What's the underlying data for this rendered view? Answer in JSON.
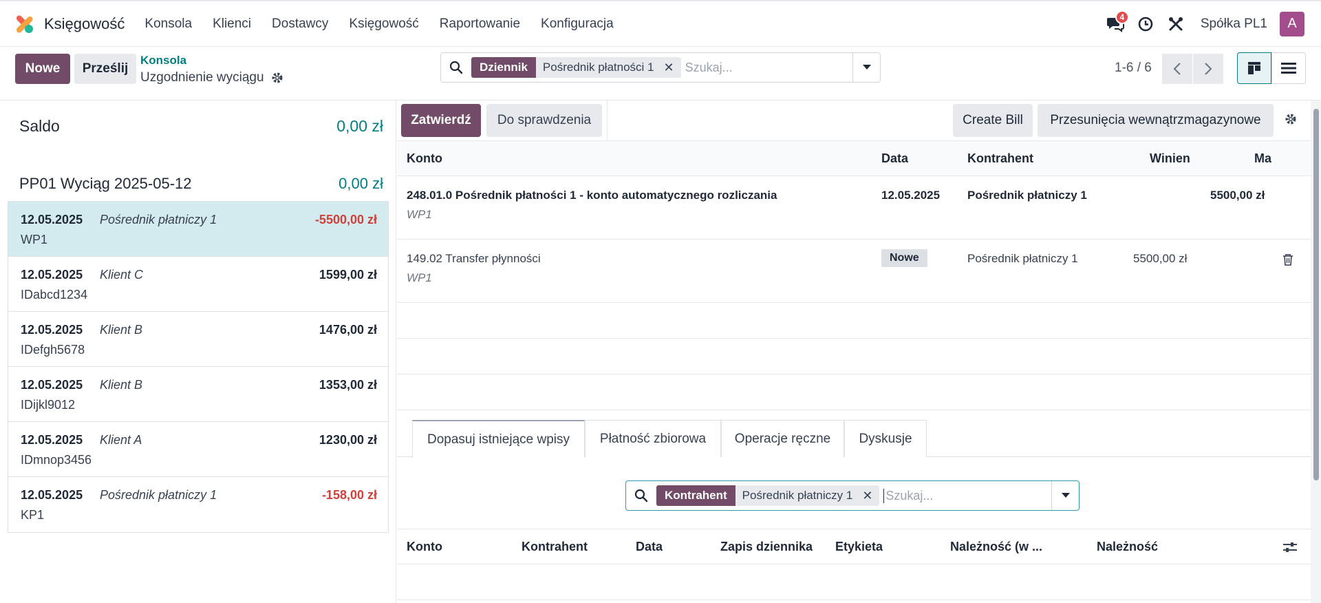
{
  "nav": {
    "app_name": "Księgowość",
    "menu": [
      "Konsola",
      "Klienci",
      "Dostawcy",
      "Księgowość",
      "Raportowanie",
      "Konfiguracja"
    ],
    "messages_badge": "4",
    "company": "Spółka PL1",
    "avatar_letter": "A"
  },
  "control": {
    "new_label": "Nowe",
    "upload_label": "Prześlij",
    "breadcrumb_parent": "Konsola",
    "breadcrumb_current": "Uzgodnienie wyciągu",
    "search": {
      "facet_label": "Dziennik",
      "facet_value": "Pośrednik płatności 1",
      "placeholder": "Szukaj..."
    },
    "pager": "1-6 / 6"
  },
  "left": {
    "balance_label": "Saldo",
    "balance_value": "0,00 zł",
    "statement_label": "PP01 Wyciąg 2025-05-12",
    "statement_value": "0,00 zł",
    "rows": [
      {
        "date": "12.05.2025",
        "partner": "Pośrednik płatniczy 1",
        "amount": "-5500,00 zł",
        "ref": "WP1"
      },
      {
        "date": "12.05.2025",
        "partner": "Klient C",
        "amount": "1599,00 zł",
        "ref": "IDabcd1234"
      },
      {
        "date": "12.05.2025",
        "partner": "Klient B",
        "amount": "1476,00 zł",
        "ref": "IDefgh5678"
      },
      {
        "date": "12.05.2025",
        "partner": "Klient B",
        "amount": "1353,00 zł",
        "ref": "IDijkl9012"
      },
      {
        "date": "12.05.2025",
        "partner": "Klient A",
        "amount": "1230,00 zł",
        "ref": "IDmnop3456"
      },
      {
        "date": "12.05.2025",
        "partner": "Pośrednik płatniczy 1",
        "amount": "-158,00 zł",
        "ref": "KP1"
      }
    ]
  },
  "right": {
    "validate_label": "Zatwierdź",
    "review_label": "Do sprawdzenia",
    "create_bill_label": "Create Bill",
    "transfer_label": "Przesunięcia wewnątrzmagazynowe",
    "columns": {
      "account": "Konto",
      "date": "Data",
      "partner": "Kontrahent",
      "debit": "Winien",
      "credit": "Ma"
    },
    "lines": [
      {
        "account": "248.01.0 Pośrednik płatności 1 - konto automatycznego rozliczania",
        "label": "WP1",
        "date": "12.05.2025",
        "partner": "Pośrednik płatniczy 1",
        "debit": "",
        "credit": "5500,00 zł"
      },
      {
        "account": "149.02 Transfer płynności",
        "label": "WP1",
        "tag": "Nowe",
        "partner": "Pośrednik płatniczy 1",
        "debit": "5500,00 zł",
        "credit": ""
      }
    ],
    "tabs": [
      "Dopasuj istniejące wpisy",
      "Płatność zbiorowa",
      "Operacje ręczne",
      "Dyskusje"
    ],
    "search2": {
      "facet_label": "Kontrahent",
      "facet_value": "Pośrednik płatniczy 1",
      "placeholder": "Szukaj..."
    },
    "grid_columns": [
      "Konto",
      "Kontrahent",
      "Data",
      "Zapis dziennika",
      "Etykieta",
      "Należność (w ...",
      "Należność"
    ]
  }
}
